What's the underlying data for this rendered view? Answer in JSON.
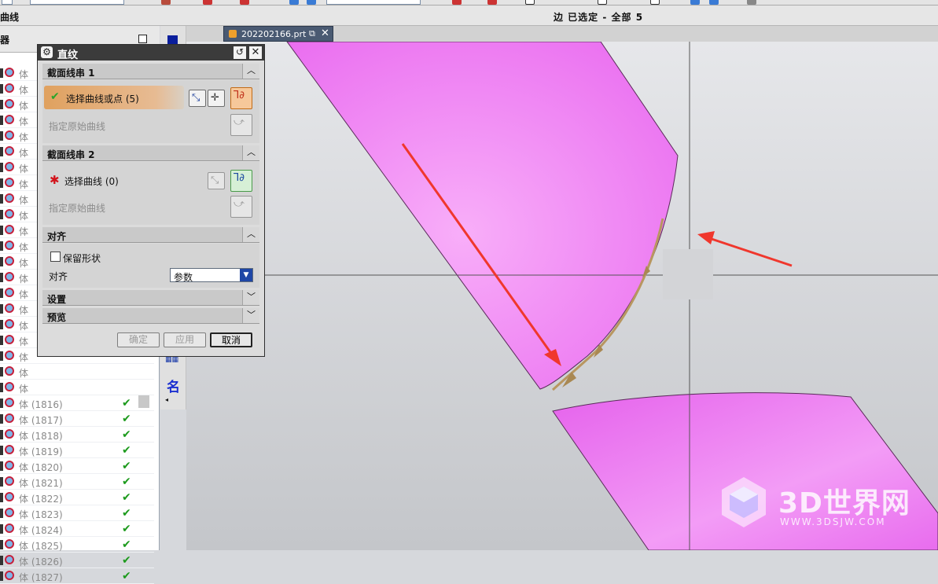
{
  "status_bar": {
    "left_label": "曲线",
    "selection_status": "边 已选定 - 全部 5"
  },
  "navigator": {
    "title": "器",
    "item_prefix": "体",
    "items": [
      {
        "label": "(1816)",
        "checked": true
      },
      {
        "label": "(1817)",
        "checked": true
      },
      {
        "label": "(1818)",
        "checked": true
      },
      {
        "label": "(1819)",
        "checked": true
      },
      {
        "label": "(1820)",
        "checked": true
      },
      {
        "label": "(1821)",
        "checked": true
      },
      {
        "label": "(1822)",
        "checked": true
      },
      {
        "label": "(1823)",
        "checked": true
      },
      {
        "label": "(1824)",
        "checked": true
      },
      {
        "label": "(1825)",
        "checked": true
      },
      {
        "label": "(1826)",
        "checked": true
      },
      {
        "label": "(1827)",
        "checked": true
      }
    ]
  },
  "tool_strip": {
    "name_label": "名"
  },
  "file_tab": {
    "filename": "202202166.prt"
  },
  "dialog": {
    "title": "直纹",
    "section1": {
      "label": "截面线串 1",
      "select_label": "选择曲线或点 (5)",
      "origin_label": "指定原始曲线"
    },
    "section2": {
      "label": "截面线串 2",
      "select_label": "选择曲线 (0)",
      "origin_label": "指定原始曲线"
    },
    "align": {
      "label": "对齐",
      "preserve_shape": "保留形状",
      "preserve_checked": false,
      "align_label": "对齐",
      "align_value": "参数"
    },
    "settings_label": "设置",
    "preview_label": "预览",
    "buttons": {
      "ok": "确定",
      "apply": "应用",
      "cancel": "取消"
    }
  },
  "watermark": {
    "brand": "3D世界网",
    "url": "WWW.3DSJW.COM"
  },
  "colors": {
    "surface": "#f08cf5",
    "arrow": "#f0372d",
    "background": "#d6d8dc",
    "accent": "#e0a15f"
  }
}
